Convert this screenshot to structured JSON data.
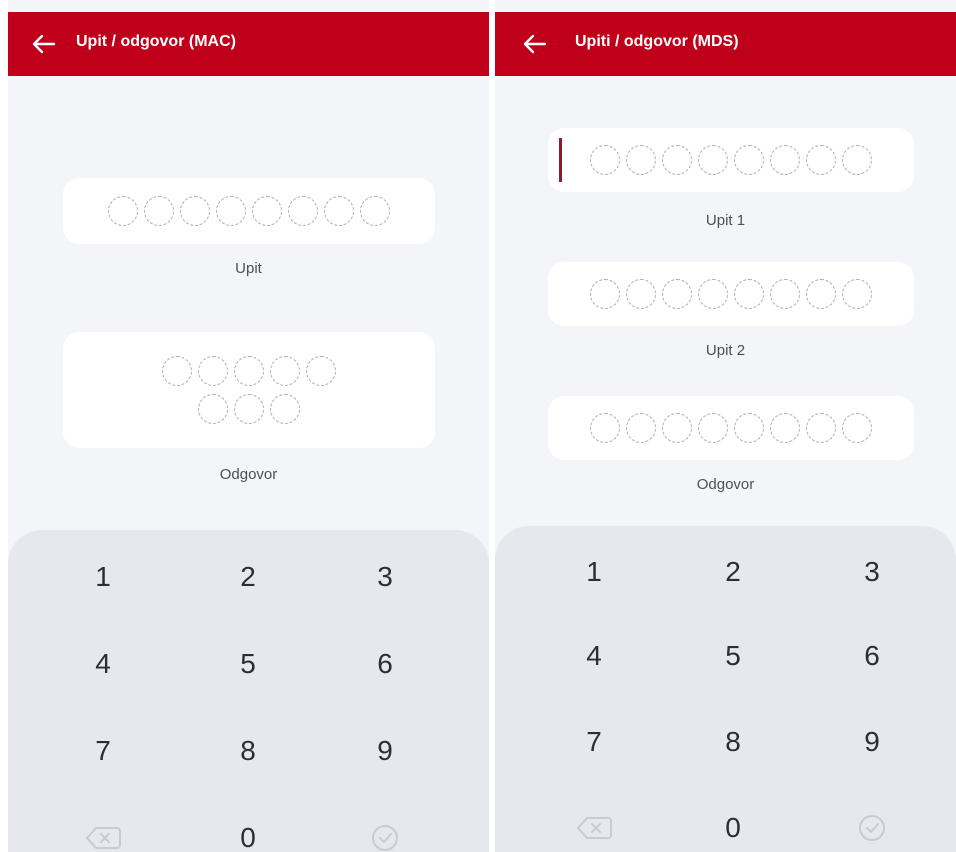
{
  "screens": [
    {
      "title": "Upit / odgovor (MAC)",
      "fields": [
        {
          "label": "Upit",
          "digits": 8
        },
        {
          "label": "Odgovor",
          "digits": 8
        }
      ]
    },
    {
      "title": "Upiti / odgovor (MDS)",
      "fields": [
        {
          "label": "Upit 1",
          "digits": 8
        },
        {
          "label": "Upit 2",
          "digits": 8
        },
        {
          "label": "Odgovor",
          "digits": 8
        }
      ]
    }
  ],
  "keypad": {
    "keys": [
      "1",
      "2",
      "3",
      "4",
      "5",
      "6",
      "7",
      "8",
      "9",
      "0"
    ],
    "backspace_icon": "backspace-icon",
    "confirm_icon": "check-circle-icon"
  },
  "colors": {
    "app_bar": "#c0001a",
    "background": "#f4f5f9",
    "keypad": "#e6e8ee",
    "cursor": "#8e1b2b"
  }
}
